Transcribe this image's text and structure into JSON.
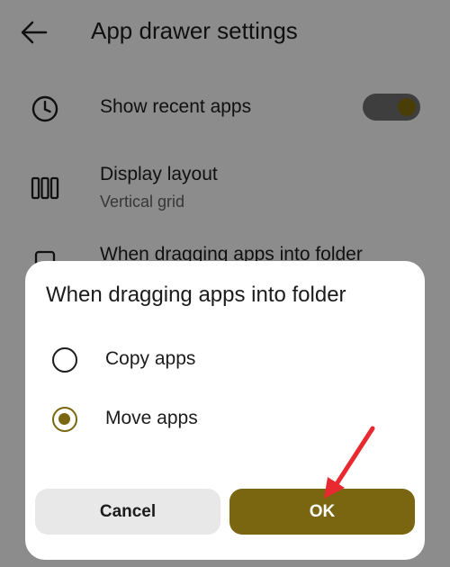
{
  "app_bar": {
    "title": "App drawer settings",
    "back_icon": "arrow-left-icon"
  },
  "settings": {
    "recent": {
      "title": "Show recent apps",
      "icon": "clock-icon",
      "toggle_on": true
    },
    "layout": {
      "title": "Display layout",
      "subtitle": "Vertical grid",
      "icon": "columns-icon"
    },
    "folder": {
      "title": "When dragging apps into folder",
      "icon": "folder-copy-icon"
    }
  },
  "dialog": {
    "title": "When dragging apps into folder",
    "options": [
      {
        "label": "Copy apps",
        "selected": false
      },
      {
        "label": "Move apps",
        "selected": true
      }
    ],
    "cancel_label": "Cancel",
    "ok_label": "OK"
  },
  "colors": {
    "accent": "#7a6510",
    "annotation_arrow": "#e8292f",
    "scrim": "rgba(0,0,0,0.42)"
  }
}
